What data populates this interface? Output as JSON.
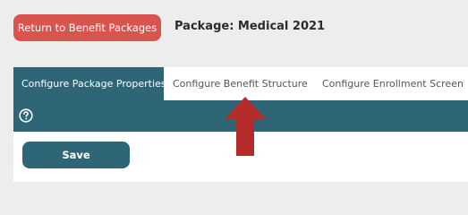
{
  "header": {
    "return_label": "Return to Benefit Packages",
    "package_title": "Package: Medical 2021"
  },
  "tabs": [
    {
      "label": "Configure Package Properties",
      "active": true
    },
    {
      "label": "Configure Benefit Structure",
      "active": false
    },
    {
      "label": "Configure Enrollment Screen",
      "active": false
    }
  ],
  "toolbar": {
    "help_icon": "question-circle-icon"
  },
  "form": {
    "save_label": "Save"
  },
  "annotation": {
    "icon": "arrow-up-icon",
    "color": "#b52a2a"
  },
  "colors": {
    "primary": "#2e6677",
    "danger": "#d9534f",
    "background": "#ededed"
  }
}
